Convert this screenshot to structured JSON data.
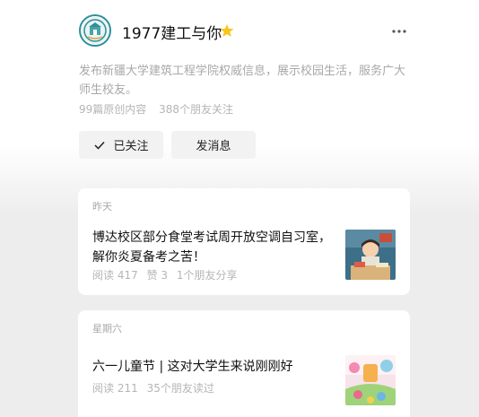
{
  "account": {
    "name": "1977建工与你",
    "description": "发布新疆大学建筑工程学院权威信息，展示校园生活，服务广大师生校友。",
    "original_count": "99篇原创内容",
    "followers": "388个朋友关注",
    "star_color": "#f5c518"
  },
  "actions": {
    "follow_label": "已关注",
    "message_label": "发消息"
  },
  "articles": [
    {
      "date": "昨天",
      "title": "博达校区部分食堂考试周开放空调自习室，解你炎夏备考之苦！",
      "reads": "阅读 417",
      "likes": "赞 3",
      "shares": "1个朋友分享",
      "thumb_icon": "cartoon-student-studying-thumbnail"
    },
    {
      "date": "星期六",
      "title": "六一儿童节 | 这对大学生来说刚刚好",
      "reads": "阅读 211",
      "friends": "35个朋友读过",
      "thumb_icon": "colorful-candy-land-thumbnail"
    }
  ]
}
